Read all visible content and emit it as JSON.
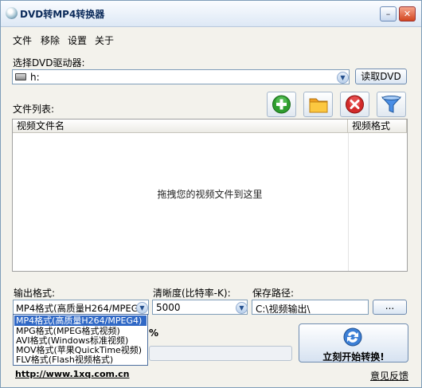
{
  "window": {
    "title": "DVD转MP4转换器",
    "minimize": "–",
    "close": "✕"
  },
  "menu": {
    "items": [
      "文件",
      "移除",
      "设置",
      "关于"
    ]
  },
  "drive": {
    "label": "选择DVD驱动器:",
    "value": "h:",
    "read_button": "读取DVD"
  },
  "file_list": {
    "label": "文件列表:",
    "columns": [
      "视频文件名",
      "视频格式"
    ],
    "empty_hint": "拖拽您的视频文件到这里"
  },
  "toolbar": {
    "icons": [
      "add-icon",
      "folder-icon",
      "remove-icon",
      "filter-icon"
    ]
  },
  "output": {
    "format_label": "输出格式:",
    "format_value": "MP4格式(高质量H264/MPEG4)",
    "format_options": [
      "MP4格式(高质量H264/MPEG4)",
      "MPG格式(MPEG格式视频)",
      "AVI格式(Windows标准视频)",
      "MOV格式(苹果QuickTime视频)",
      "FLV格式(Flash视频格式)"
    ],
    "quality_label": "清晰度(比特率-K):",
    "quality_value": "5000",
    "path_label": "保存路径:",
    "path_value": "C:\\视频输出\\",
    "browse_button": "..."
  },
  "progress": {
    "percent_symbol": "%",
    "value": 0
  },
  "convert_button": "立刻开始转换!",
  "footer": {
    "website": "http://www.1xq.com.cn",
    "feedback": "意见反馈"
  },
  "colors": {
    "selection": "#3169c6",
    "window_bg": "#f3f2ec",
    "border": "#7f9db9"
  }
}
